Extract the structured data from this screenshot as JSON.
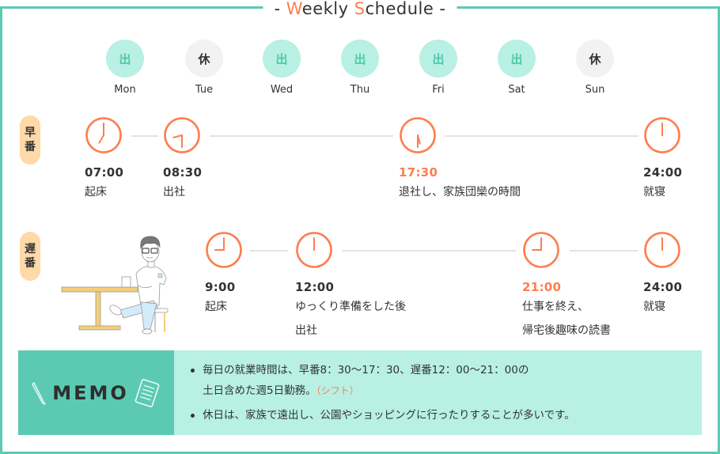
{
  "title": {
    "prefix": "- ",
    "w_accent": "W",
    "w_rest": "eekly ",
    "s_accent": "S",
    "s_rest": "chedule",
    "suffix": " -"
  },
  "colors": {
    "teal": "#5ccab2",
    "mint": "#b8f0e4",
    "orange": "#ff7d4f",
    "peach": "#ffd9a8",
    "gray": "#f2f2f2"
  },
  "week": [
    {
      "day": "Mon",
      "mark": "出",
      "status": "work"
    },
    {
      "day": "Tue",
      "mark": "休",
      "status": "off"
    },
    {
      "day": "Wed",
      "mark": "出",
      "status": "work"
    },
    {
      "day": "Thu",
      "mark": "出",
      "status": "work"
    },
    {
      "day": "Fri",
      "mark": "出",
      "status": "work"
    },
    {
      "day": "Sat",
      "mark": "出",
      "status": "work"
    },
    {
      "day": "Sun",
      "mark": "休",
      "status": "off"
    }
  ],
  "early_shift": {
    "label_1": "早",
    "label_2": "番",
    "events": [
      {
        "time": "07:00",
        "desc_1": "起床",
        "desc_2": "",
        "hour": 7,
        "minute": 0,
        "highlight": false
      },
      {
        "time": "08:30",
        "desc_1": "出社",
        "desc_2": "",
        "hour": 8,
        "minute": 30,
        "highlight": false
      },
      {
        "time": "17:30",
        "desc_1": "退社し、家族団欒の時間",
        "desc_2": "",
        "hour": 17,
        "minute": 30,
        "highlight": true
      },
      {
        "time": "24:00",
        "desc_1": "就寝",
        "desc_2": "",
        "hour": 24,
        "minute": 0,
        "highlight": false
      }
    ]
  },
  "late_shift": {
    "label_1": "遅",
    "label_2": "番",
    "events": [
      {
        "time": "9:00",
        "desc_1": "起床",
        "desc_2": "",
        "hour": 9,
        "minute": 0,
        "highlight": false
      },
      {
        "time": "12:00",
        "desc_1": "ゆっくり準備をした後",
        "desc_2": "出社",
        "hour": 12,
        "minute": 0,
        "highlight": false
      },
      {
        "time": "21:00",
        "desc_1": "仕事を終え、",
        "desc_2": "帰宅後趣味の読書",
        "hour": 21,
        "minute": 0,
        "highlight": true
      },
      {
        "time": "24:00",
        "desc_1": "就寝",
        "desc_2": "",
        "hour": 24,
        "minute": 0,
        "highlight": false
      }
    ]
  },
  "memo": {
    "title": "MEMO",
    "items": [
      {
        "line_1": "毎日の就業時間は、早番8：30〜17：30、遅番12：00〜21：00の",
        "line_2": "土日含めた週5日勤務。",
        "note": "（シフト）"
      },
      {
        "line_1": "休日は、家族で遠出し、公園やショッピングに行ったりすることが多いです。",
        "line_2": "",
        "note": ""
      }
    ]
  }
}
